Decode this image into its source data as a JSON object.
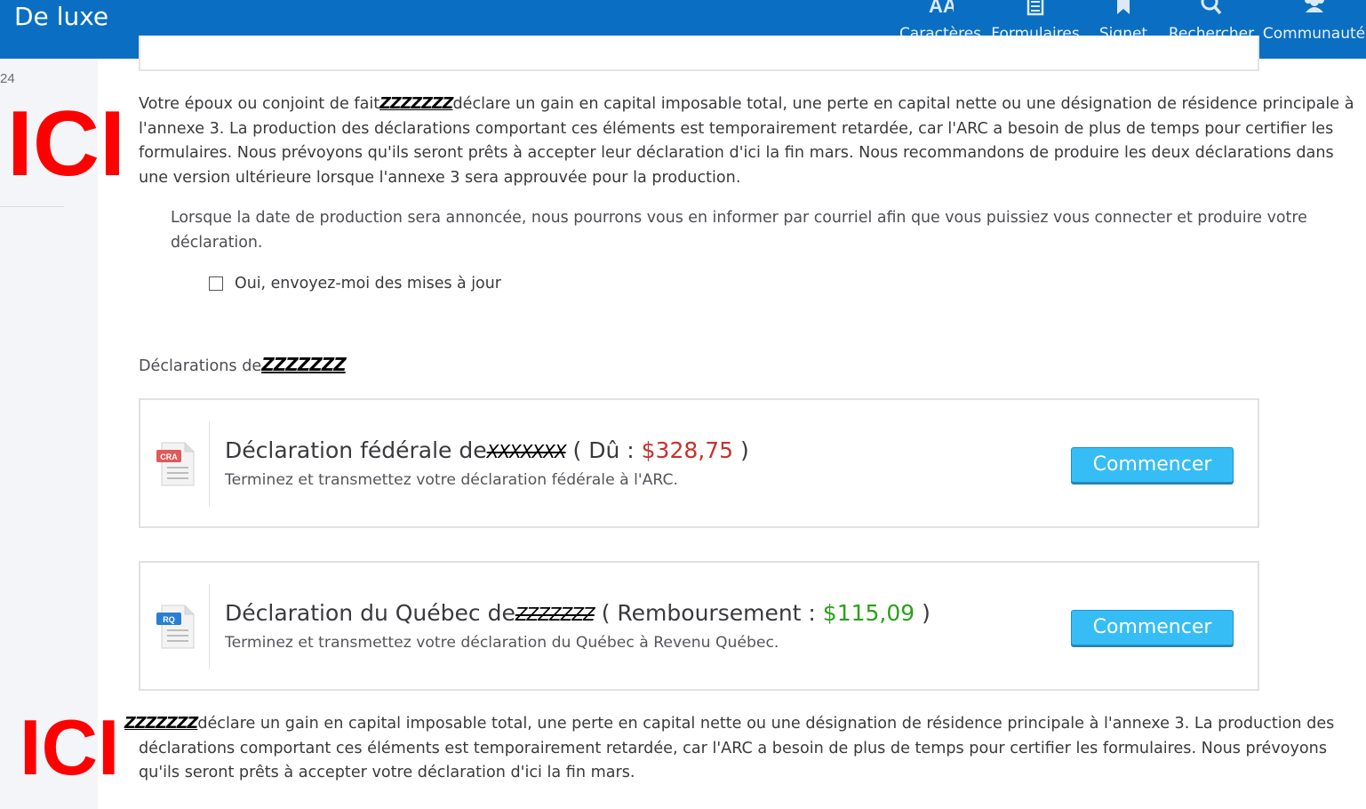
{
  "header": {
    "brand": "De luxe",
    "nav": [
      {
        "label": "Caractères",
        "icon": "font-size-icon"
      },
      {
        "label": "Formulaires",
        "icon": "forms-icon"
      },
      {
        "label": "Signet",
        "icon": "bookmark-icon"
      },
      {
        "label": "Rechercher",
        "icon": "search-icon"
      },
      {
        "label": "Communauté",
        "icon": "community-icon"
      }
    ]
  },
  "rail": {
    "number": "24"
  },
  "annotations": {
    "ici_top": "ICI",
    "ici_bottom": "ICI"
  },
  "notice_spouse": {
    "prefix": "Votre époux ou conjoint de fait",
    "redacted": "ZZZZZZZ",
    "text": "déclare un gain en capital imposable total, une perte en capital nette ou une désignation de résidence principale à l'annexe 3. La production des déclarations comportant ces éléments est temporairement retardée, car l'ARC a besoin de plus de temps pour certifier les formulaires. Nous prévoyons qu'ils seront prêts à accepter leur déclaration d'ici la fin mars. Nous recommandons de produire les deux déclarations dans une version ultérieure lorsque l'annexe 3 sera approuvée pour la production."
  },
  "notify": {
    "text": "Lorsque la date de production sera annoncée, nous pourrons vous en informer par courriel afin que vous puissiez vous connecter et produire votre déclaration.",
    "checkbox_label": "Oui, envoyez-moi des mises à jour"
  },
  "declarations": {
    "title_prefix": "Déclarations de",
    "title_redacted": "ZZZZZZZ",
    "items": [
      {
        "title_prefix": "Déclaration fédérale de",
        "redacted": "XXXXXXX",
        "amount_label": "( Dû : ",
        "amount": "$328,75",
        "amount_suffix": " )",
        "subtitle": "Terminez et transmettez votre déclaration fédérale à l'ARC.",
        "badge": "CRA",
        "button": "Commencer"
      },
      {
        "title_prefix": "Déclaration du Québec de",
        "redacted": "ZZZZZZZ",
        "amount_label": "( Remboursement : ",
        "amount": "$115,09",
        "amount_suffix": " )",
        "subtitle": "Terminez et transmettez votre déclaration du Québec à Revenu Québec.",
        "badge": "RQ",
        "button": "Commencer"
      }
    ]
  },
  "notice_self": {
    "redacted": "ZZZZZZZ",
    "text": "déclare un gain en capital imposable total, une perte en capital nette ou une désignation de résidence principale à l'annexe 3. La production des déclarations comportant ces éléments est temporairement retardée, car l'ARC a besoin de plus de temps pour certifier les formulaires. Nous prévoyons qu'ils seront prêts à accepter votre déclaration d'ici la fin mars."
  },
  "colors": {
    "header": "#0a6fc2",
    "button": "#36bdf5",
    "due": "#c9302c",
    "refund": "#2ca01c",
    "annotation": "#ff0000"
  }
}
